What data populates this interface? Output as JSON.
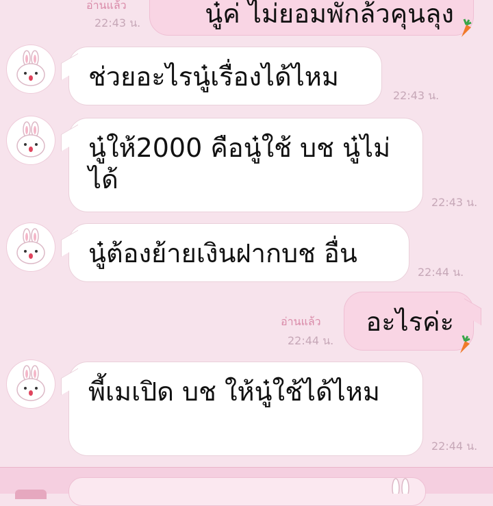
{
  "messages": [
    {
      "id": "m0",
      "from": "me",
      "text": "นู๋ค่ ไม่ยอมพักล้วคุนลุง",
      "read": "อ่านแล้ว",
      "time": "22:43 น."
    },
    {
      "id": "m1",
      "from": "them",
      "text": "ช่วยอะไรนู๋เรื่องได้ไหม",
      "time": "22:43 น."
    },
    {
      "id": "m2",
      "from": "them",
      "text": "นู๋ให้2000 คือนู๋ใช้ บช นู๋ไม่ได้",
      "time": "22:43 น."
    },
    {
      "id": "m3",
      "from": "them",
      "text": "นู๋ต้องย้ายเงินฝากบช อื่น",
      "time": "22:44 น."
    },
    {
      "id": "m4",
      "from": "me",
      "text": "อะไรค่ะ",
      "read": "อ่านแล้ว",
      "time": "22:44 น."
    },
    {
      "id": "m5",
      "from": "them",
      "text": "พี้เมเปิด บช ให้นู๋ใช้ได้ไหม",
      "time": "22:44 น."
    }
  ],
  "icons": {
    "avatar": "bunny-avatar-icon",
    "sticker": "carrot-icon"
  },
  "colors": {
    "background": "#f7e3ec",
    "incoming_bubble": "#ffffff",
    "outgoing_bubble": "#f9d5e4",
    "timestamp": "#c6a7b7",
    "read_label": "#d98aa8"
  }
}
